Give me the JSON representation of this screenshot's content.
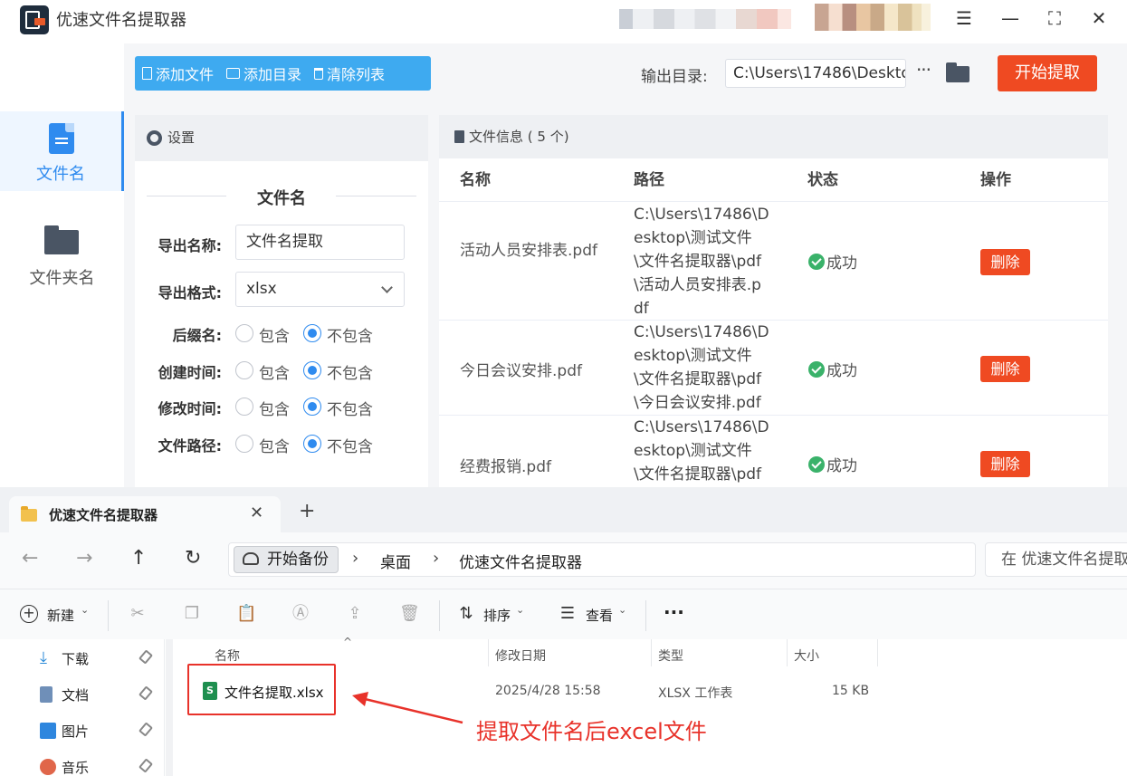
{
  "app": {
    "title": "优速文件名提取器",
    "window_buttons": [
      "menu",
      "minimize",
      "maximize",
      "close"
    ]
  },
  "nav": {
    "items": [
      {
        "label": "文件名",
        "icon": "file-icon",
        "active": true
      },
      {
        "label": "文件夹名",
        "icon": "folder-icon",
        "active": false
      }
    ]
  },
  "toolbar": {
    "add_file": "添加文件",
    "add_dir": "添加目录",
    "clear_list": "清除列表",
    "output_label": "输出目录:",
    "output_path": "C:\\Users\\17486\\Deskto",
    "more": "···",
    "start": "开始提取"
  },
  "settings": {
    "header": "设置",
    "section_title": "文件名",
    "export_name_label": "导出名称:",
    "export_name_value": "文件名提取",
    "export_format_label": "导出格式:",
    "export_format_value": "xlsx",
    "options": [
      {
        "label": "后缀名:",
        "include": "包含",
        "exclude": "不包含",
        "selected": "exclude"
      },
      {
        "label": "创建时间:",
        "include": "包含",
        "exclude": "不包含",
        "selected": "exclude"
      },
      {
        "label": "修改时间:",
        "include": "包含",
        "exclude": "不包含",
        "selected": "exclude"
      },
      {
        "label": "文件路径:",
        "include": "包含",
        "exclude": "不包含",
        "selected": "exclude"
      }
    ]
  },
  "file_info": {
    "header": "文件信息 ( 5 个)",
    "columns": [
      "名称",
      "路径",
      "状态",
      "操作"
    ],
    "rows": [
      {
        "name": "活动人员安排表.pdf",
        "path": "C:\\Users\\17486\\Desktop\\测试文件\\文件名提取器\\pdf\\活动人员安排表.pdf",
        "status": "成功",
        "action": "删除"
      },
      {
        "name": "今日会议安排.pdf",
        "path": "C:\\Users\\17486\\Desktop\\测试文件\\文件名提取器\\pdf\\今日会议安排.pdf",
        "status": "成功",
        "action": "删除"
      },
      {
        "name": "经费报销.pdf",
        "path": "C:\\Users\\17486\\Desktop\\测试文件\\文件名提取器\\pdf",
        "status": "成功",
        "action": "删除"
      }
    ]
  },
  "explorer": {
    "tab_title": "优速文件名提取器",
    "new_tab": "+",
    "breadcrumb": [
      "开始备份",
      "桌面",
      "优速文件名提取器"
    ],
    "search_placeholder": "在 优速文件名提取",
    "commands": {
      "new": "新建",
      "sort": "排序",
      "view": "查看",
      "more": "···"
    },
    "sidebar": [
      {
        "label": "下载",
        "icon": "download-icon"
      },
      {
        "label": "文档",
        "icon": "document-icon"
      },
      {
        "label": "图片",
        "icon": "pictures-icon"
      },
      {
        "label": "音乐",
        "icon": "music-icon"
      }
    ],
    "columns": [
      "名称",
      "修改日期",
      "类型",
      "大小"
    ],
    "files": [
      {
        "name": "文件名提取.xlsx",
        "modified": "2025/4/28 15:58",
        "type": "XLSX 工作表",
        "size": "15 KB"
      }
    ],
    "annotation": "提取文件名后excel文件",
    "annotation_color": "#e8322a"
  },
  "colors": {
    "accent": "#2f8bef",
    "toolbar_button": "#3eaaf0",
    "danger": "#ef4a22",
    "success": "#3ab26a"
  }
}
